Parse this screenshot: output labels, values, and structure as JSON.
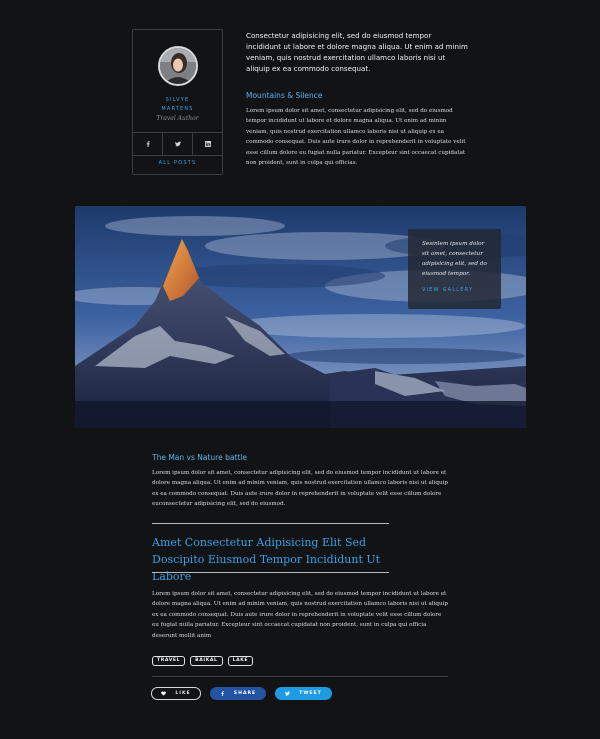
{
  "author": {
    "name_line1": "SILVYE",
    "name_line2": "MARTENS",
    "role": "Travel Author",
    "all_posts": "ALL POSTS",
    "social_icons": [
      "facebook-icon",
      "twitter-icon",
      "linkedin-icon"
    ]
  },
  "intro": {
    "lead": "Consectetur adipisicing elit, sed do eiusmod tempor incididunt ut labore et dolore magna aliqua. Ut enim ad minim veniam, quis nostrud exercitation ullamco laboris nisi ut aliquip ex ea commodo consequat.",
    "heading": "Mountains & Silence",
    "body": "Lorem ipsum dolor sit amet, consectetur adipisicing elit, sed do eiusmod tempor incididunt ut labore et dolore magna aliqua. Ut enim ad minim veniam, quis nostrud exercitation ullamco laboris nisi ut aliquip ex ea commodo consequat. Duis aute irure dolor in reprehenderit in voluptate velit esse cillum dolore eu fugiat nulla pariatur. Excepteur sint occaecat cupidatat non proident, sunt in culpa qui officias."
  },
  "hero": {
    "overlay_text": "Sesinlem ipsum dolor sit amet, consectetur adipisicing elit, sed do eiusmod tempor.",
    "gallery_link": "VIEW GALLERY"
  },
  "section": {
    "heading": "The Man vs Nature battle",
    "body": "Lorem ipsum dolor sit amet, consectetur adipisicing elit, sed do eiusmod tempor incididunt ut labore et dolore magna aliqua. Ut enim ad minim veniam, quis nostrud exercitation ullamco laboris nisi ut aliquip ex ea commodo consequat. Duis aute irure dolor in reprehenderit in voluptate velit esse cillum dolore euconsectetur adipisicing elit, sed do eiusmod."
  },
  "quote": "Amet Consectetur Adipisicing Elit Sed Doscipito Eiusmod Tempor Incididunt Ut Labore",
  "closing_body": "Lorem ipsum dolor sit amet, consectetur adipisicing elit, sed do eiusmod tempor incididunt ut labore et dolore magna aliqua. Ut enim ad minim veniam, quis nostrud exercitation ullamco laboris nisi ut aliquip ex ea commodo consequat. Duis aute irure dolor in reprehenderit in voluptate velit esse cillum dolore eu fugiat nulla pariatur. Excepteur sint occaecat cupidatat non proident, sunt in culpa qui officia deserunt mollit anim",
  "tags": [
    "TRAVEL",
    "BAIKAL",
    "LAKE"
  ],
  "actions": {
    "like": "LIKE",
    "share": "SHARE",
    "tweet": "TWEET"
  },
  "colors": {
    "background": "#121315",
    "accent": "#3e9fe6",
    "facebook": "#2453a3",
    "twitter": "#1e9be3"
  }
}
